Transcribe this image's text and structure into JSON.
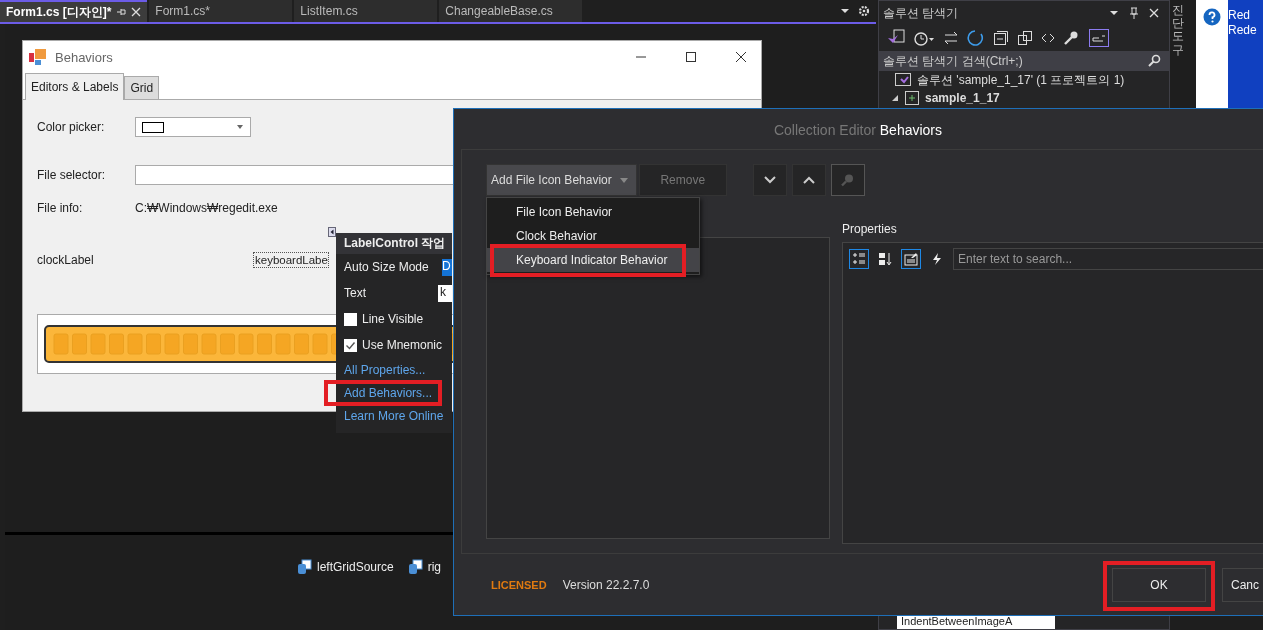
{
  "editor_tabs": [
    {
      "label": "Form1.cs [디자인]*",
      "selected": true
    },
    {
      "label": "Form1.cs*",
      "selected": false
    },
    {
      "label": "ListItem.cs",
      "selected": false
    },
    {
      "label": "ChangeableBase.cs",
      "selected": false
    }
  ],
  "form": {
    "title": "Behaviors",
    "tabs": [
      {
        "label": "Editors & Labels",
        "selected": true
      },
      {
        "label": "Grid",
        "selected": false
      }
    ],
    "fields": [
      {
        "kind": "color",
        "label": "Color picker:"
      },
      {
        "kind": "file",
        "label": "File selector:"
      },
      {
        "kind": "info",
        "label": "File info:",
        "value": "C:₩Windows₩regedit.exe"
      }
    ],
    "clock_label": "clockLabel",
    "keyboard_label": "keyboardLabe"
  },
  "smart_tag": {
    "title": "LabelControl 작업",
    "rows": [
      {
        "kind": "select",
        "label": "Auto Size Mode",
        "value": "D"
      },
      {
        "kind": "text",
        "label": "Text",
        "value": "k"
      },
      {
        "kind": "check",
        "label": "Line Visible",
        "checked": false
      },
      {
        "kind": "check",
        "label": "Use Mnemonic",
        "checked": true
      },
      {
        "kind": "link",
        "label": "All Properties...",
        "highlighted": false
      },
      {
        "kind": "link",
        "label": "Add Behaviors...",
        "highlighted": true
      },
      {
        "kind": "link",
        "label": "Learn More Online",
        "highlighted": false
      }
    ]
  },
  "tray": [
    "leftGridSource",
    "rig"
  ],
  "solution_explorer": {
    "title": "솔루션 탐색기",
    "search_placeholder": "솔루션 탐색기 검색(Ctrl+;)",
    "tree": [
      {
        "label": "솔루션 'sample_1_17'  (1 프로젝트의 1)",
        "children": [
          {
            "label": "sample_1_17"
          }
        ]
      }
    ],
    "property_row": "IndentBetweenImageA"
  },
  "side_strip": "진단 도구",
  "desktop": {
    "text_lines": [
      "Red",
      "Rede"
    ]
  },
  "dialog": {
    "title_prefix": "Collection Editor",
    "title_name": "Behaviors",
    "add_button": "Add File Icon Behavior",
    "remove_button": {
      "label": "Remove",
      "disabled": true
    },
    "menu": [
      {
        "label": "File Icon Behavior",
        "selected": false,
        "highlighted": false
      },
      {
        "label": "Clock Behavior",
        "selected": false,
        "highlighted": false
      },
      {
        "label": "Keyboard Indicator Behavior",
        "selected": true,
        "highlighted": true
      }
    ],
    "properties_label": "Properties",
    "search_placeholder": "Enter text to search...",
    "prop_tools": [
      {
        "kind": "categorized",
        "selected": true
      },
      {
        "kind": "alphabetical",
        "selected": false
      },
      {
        "kind": "properties",
        "selected": true
      },
      {
        "kind": "events",
        "selected": false
      }
    ],
    "license": "LICENSED",
    "version": "Version 22.2.7.0",
    "ok": {
      "label": "OK",
      "highlighted": true
    },
    "cancel": "Canc"
  }
}
